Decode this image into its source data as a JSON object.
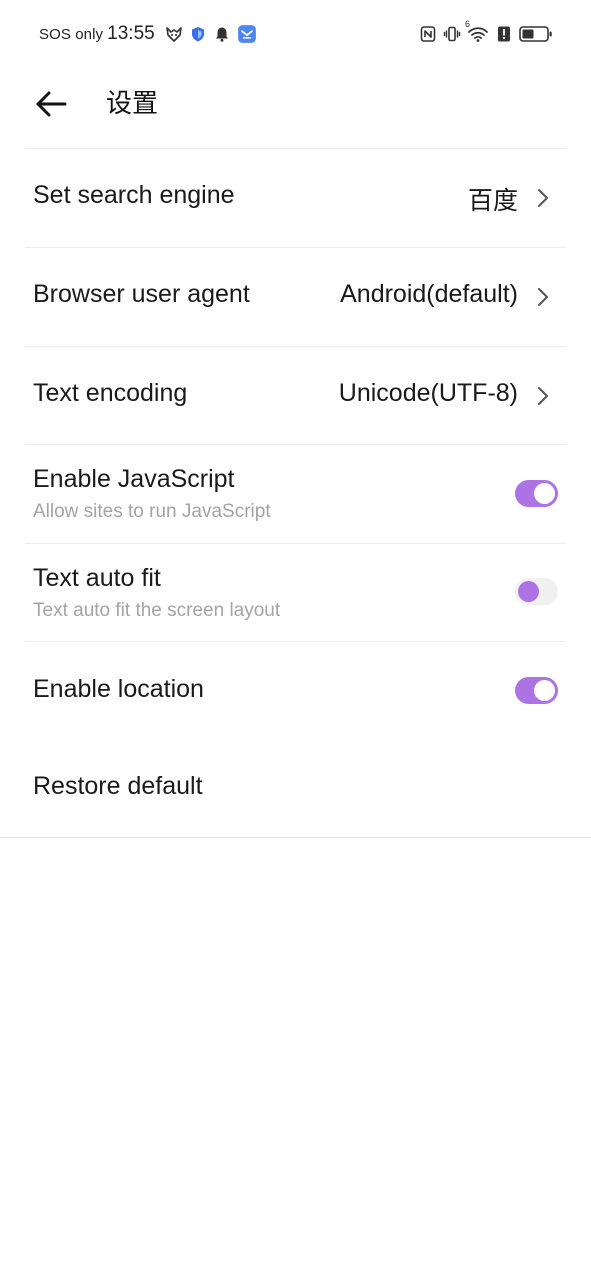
{
  "status_bar": {
    "carrier_text": "SOS only",
    "time": "13:55",
    "left_icons": [
      "fox-icon",
      "shield-icon",
      "bell-icon",
      "app-notification-icon"
    ],
    "right_icons": [
      "nfc-icon",
      "vibrate-icon",
      "wifi-icon",
      "alert-icon",
      "battery-icon"
    ],
    "wifi_badge": "6"
  },
  "header": {
    "back_icon": "arrow-left-icon",
    "title": "设置"
  },
  "settings": {
    "search_engine": {
      "label": "Set search engine",
      "value": "百度"
    },
    "user_agent": {
      "label": "Browser user agent",
      "value": "Android(default)"
    },
    "text_encoding": {
      "label": "Text encoding",
      "value": "Unicode(UTF-8)"
    },
    "javascript": {
      "label": "Enable JavaScript",
      "sublabel": "Allow sites to run JavaScript",
      "enabled": true
    },
    "auto_fit": {
      "label": "Text auto fit",
      "sublabel": "Text auto fit the screen layout",
      "enabled": false
    },
    "location": {
      "label": "Enable location",
      "enabled": true
    },
    "restore": {
      "label": "Restore default"
    }
  },
  "colors": {
    "accent": "#ad72e4",
    "toggle_off_track": "#f0f0f0",
    "secondary_text": "#a4a4a4",
    "divider": "#ececec"
  }
}
